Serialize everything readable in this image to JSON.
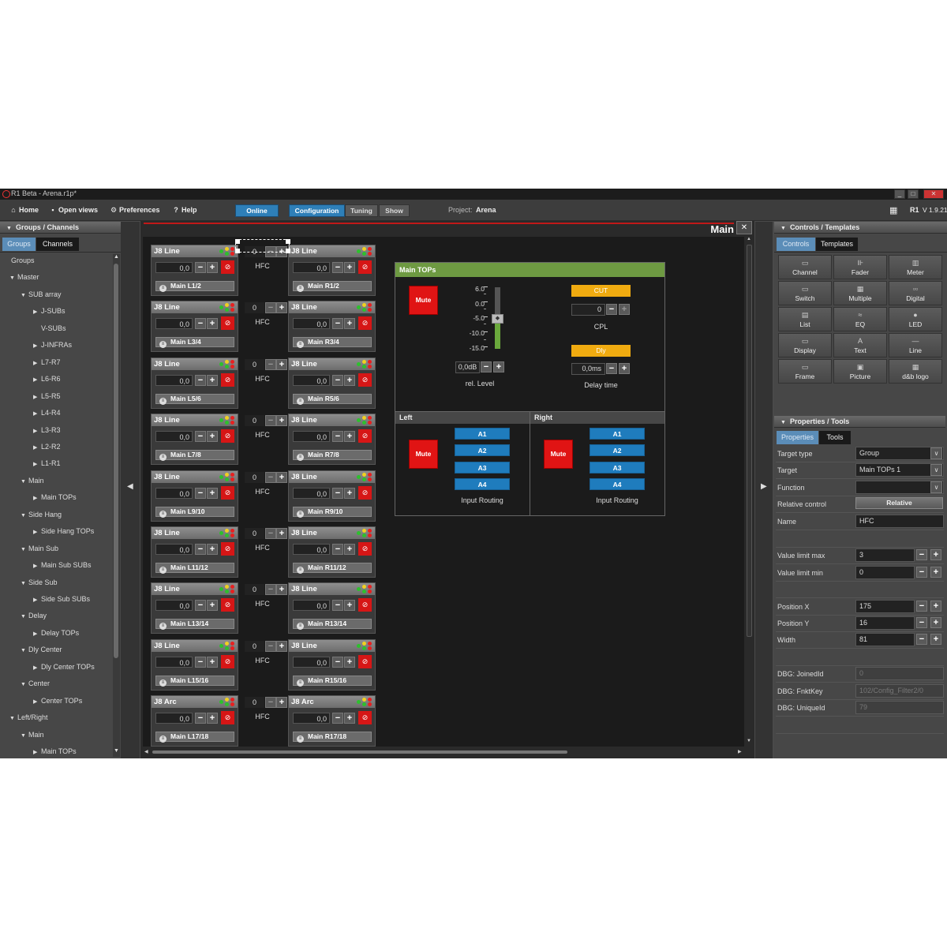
{
  "window": {
    "title": "R1 Beta - Arena.r1p*"
  },
  "menu": {
    "home": "Home",
    "open_views": "Open views",
    "preferences": "Preferences",
    "help": "Help",
    "online": "Online",
    "configuration": "Configuration",
    "tuning": "Tuning",
    "show": "Show",
    "project_label": "Project:",
    "project_name": "Arena",
    "app_name": "R1",
    "version": "V 1.9.21"
  },
  "left_panel": {
    "title": "Groups / Channels",
    "tabs": [
      "Groups",
      "Channels"
    ],
    "tree": [
      {
        "label": "Groups",
        "depth": 0,
        "expander": ""
      },
      {
        "label": "Master",
        "depth": 1,
        "expander": "open"
      },
      {
        "label": "SUB array",
        "depth": 2,
        "expander": "open"
      },
      {
        "label": "J-SUBs",
        "depth": 3,
        "expander": "closed"
      },
      {
        "label": "V-SUBs",
        "depth": 3,
        "expander": ""
      },
      {
        "label": "J-INFRAs",
        "depth": 3,
        "expander": "closed"
      },
      {
        "label": "L7-R7",
        "depth": 3,
        "expander": "closed"
      },
      {
        "label": "L6-R6",
        "depth": 3,
        "expander": "closed"
      },
      {
        "label": "L5-R5",
        "depth": 3,
        "expander": "closed"
      },
      {
        "label": "L4-R4",
        "depth": 3,
        "expander": "closed"
      },
      {
        "label": "L3-R3",
        "depth": 3,
        "expander": "closed"
      },
      {
        "label": "L2-R2",
        "depth": 3,
        "expander": "closed"
      },
      {
        "label": "L1-R1",
        "depth": 3,
        "expander": "closed"
      },
      {
        "label": "Main",
        "depth": 2,
        "expander": "open"
      },
      {
        "label": "Main TOPs",
        "depth": 3,
        "expander": "closed"
      },
      {
        "label": "Side Hang",
        "depth": 2,
        "expander": "open"
      },
      {
        "label": "Side Hang TOPs",
        "depth": 3,
        "expander": "closed"
      },
      {
        "label": "Main Sub",
        "depth": 2,
        "expander": "open"
      },
      {
        "label": "Main Sub SUBs",
        "depth": 3,
        "expander": "closed"
      },
      {
        "label": "Side Sub",
        "depth": 2,
        "expander": "open"
      },
      {
        "label": "Side Sub SUBs",
        "depth": 3,
        "expander": "closed"
      },
      {
        "label": "Delay",
        "depth": 2,
        "expander": "open"
      },
      {
        "label": "Delay TOPs",
        "depth": 3,
        "expander": "closed"
      },
      {
        "label": "Dly Center",
        "depth": 2,
        "expander": "open"
      },
      {
        "label": "Dly Center TOPs",
        "depth": 3,
        "expander": "closed"
      },
      {
        "label": "Center",
        "depth": 2,
        "expander": "open"
      },
      {
        "label": "Center TOPs",
        "depth": 3,
        "expander": "closed"
      },
      {
        "label": "Left/Right",
        "depth": 1,
        "expander": "open"
      },
      {
        "label": "Main",
        "depth": 2,
        "expander": "open"
      },
      {
        "label": "Main TOPs",
        "depth": 3,
        "expander": "closed"
      }
    ]
  },
  "view": {
    "title": "Main",
    "close": "✕",
    "rows": [
      {
        "left_type": "J8 Line",
        "right_type": "J8 Line",
        "left_name": "Main L1/2",
        "right_name": "Main R1/2",
        "hfc": "0"
      },
      {
        "left_type": "J8 Line",
        "right_type": "J8 Line",
        "left_name": "Main L3/4",
        "right_name": "Main R3/4",
        "hfc": "0"
      },
      {
        "left_type": "J8 Line",
        "right_type": "J8 Line",
        "left_name": "Main L5/6",
        "right_name": "Main R5/6",
        "hfc": "0"
      },
      {
        "left_type": "J8 Line",
        "right_type": "J8 Line",
        "left_name": "Main L7/8",
        "right_name": "Main R7/8",
        "hfc": "0"
      },
      {
        "left_type": "J8 Line",
        "right_type": "J8 Line",
        "left_name": "Main L9/10",
        "right_name": "Main R9/10",
        "hfc": "0"
      },
      {
        "left_type": "J8 Line",
        "right_type": "J8 Line",
        "left_name": "Main L11/12",
        "right_name": "Main R11/12",
        "hfc": "0"
      },
      {
        "left_type": "J8 Line",
        "right_type": "J8 Line",
        "left_name": "Main L13/14",
        "right_name": "Main R13/14",
        "hfc": "0"
      },
      {
        "left_type": "J8 Line",
        "right_type": "J8 Line",
        "left_name": "Main L15/16",
        "right_name": "Main R15/16",
        "hfc": "0"
      },
      {
        "left_type": "J8 Arc",
        "right_type": "J8 Arc",
        "left_name": "Main L17/18",
        "right_name": "Main R17/18",
        "hfc": "0"
      }
    ],
    "level_value": "0,0",
    "hfc_label": "HFC",
    "minus": "−",
    "plus": "+",
    "main_tops": {
      "title": "Main TOPs",
      "mute": "Mute",
      "scale": [
        "6.0",
        "0.0",
        "-5.0",
        "-10.0",
        "-15.0"
      ],
      "level_value": "0,0dB",
      "level_label": "rel. Level",
      "cut": "CUT",
      "cpl_value": "0",
      "cpl_label": "CPL",
      "dly": "Dly",
      "delay_value": "0,0ms",
      "delay_label": "Delay time",
      "left": {
        "title": "Left",
        "mute": "Mute",
        "inputs": [
          "A1",
          "A2",
          "A3",
          "A4"
        ],
        "label": "Input Routing"
      },
      "right": {
        "title": "Right",
        "mute": "Mute",
        "inputs": [
          "A1",
          "A2",
          "A3",
          "A4"
        ],
        "label": "Input Routing"
      }
    }
  },
  "right_panel": {
    "title": "Controls / Templates",
    "tabs": [
      "Controls",
      "Templates"
    ],
    "controls": [
      {
        "label": "Channel",
        "icon": "▭"
      },
      {
        "label": "Fader",
        "icon": "⊪"
      },
      {
        "label": "Meter",
        "icon": "▥"
      },
      {
        "label": "Switch",
        "icon": "▭"
      },
      {
        "label": "Multiple",
        "icon": "▦"
      },
      {
        "label": "Digital",
        "icon": "▫▫"
      },
      {
        "label": "List",
        "icon": "▤"
      },
      {
        "label": "EQ",
        "icon": "≈"
      },
      {
        "label": "LED",
        "icon": "●"
      },
      {
        "label": "Display",
        "icon": "▭"
      },
      {
        "label": "Text",
        "icon": "A"
      },
      {
        "label": "Line",
        "icon": "—"
      },
      {
        "label": "Frame",
        "icon": "▭"
      },
      {
        "label": "Picture",
        "icon": "▣"
      },
      {
        "label": "d&b logo",
        "icon": "▦"
      }
    ],
    "properties_title": "Properties / Tools",
    "properties_tabs": [
      "Properties",
      "Tools"
    ],
    "properties": {
      "target_type_label": "Target type",
      "target_type": "Group",
      "target_label": "Target",
      "target": "Main TOPs 1",
      "function_label": "Function",
      "function": "",
      "relative_label": "Relative control",
      "relative": "Relative",
      "name_label": "Name",
      "name": "HFC",
      "vmax_label": "Value limit max",
      "vmax": "3",
      "vmin_label": "Value limit min",
      "vmin": "0",
      "posx_label": "Position X",
      "posx": "175",
      "posy_label": "Position Y",
      "posy": "16",
      "width_label": "Width",
      "width": "81",
      "dbg_joined_label": "DBG: JoinedId",
      "dbg_joined": "0",
      "dbg_fnkt_label": "DBG: FnktKey",
      "dbg_fnkt": "102/Config_Filter2/0",
      "dbg_unique_label": "DBG: UniqueId",
      "dbg_unique": "79"
    }
  }
}
